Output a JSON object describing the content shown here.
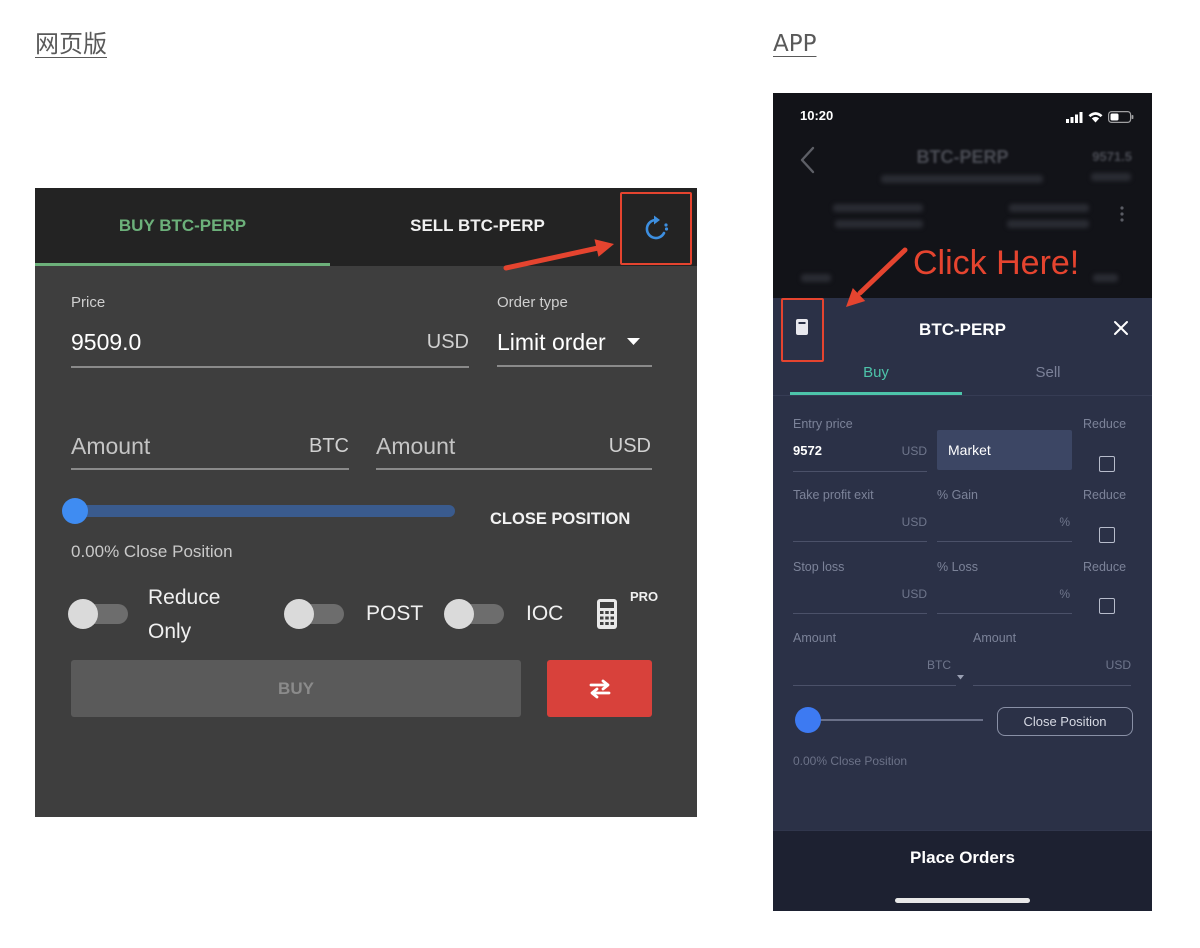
{
  "section_labels": {
    "web": "网页版",
    "app": "APP"
  },
  "annotations": {
    "click_here": "Click Here!"
  },
  "web": {
    "tabs": [
      {
        "label": "BUY BTC-PERP",
        "active": true
      },
      {
        "label": "SELL BTC-PERP",
        "active": false
      }
    ],
    "refresh_icon": "refresh-icon",
    "price": {
      "label": "Price",
      "value": "9509.0",
      "unit": "USD"
    },
    "order_type": {
      "label": "Order type",
      "value": "Limit order",
      "icon": "caret-down-icon"
    },
    "amount_btc": {
      "placeholder": "Amount",
      "unit": "BTC"
    },
    "amount_usd": {
      "placeholder": "Amount",
      "unit": "USD"
    },
    "slider": {
      "percent": 0
    },
    "close_position_button": "CLOSE POSITION",
    "close_position_status": "0.00% Close Position",
    "toggles": [
      {
        "label": "Reduce Only",
        "on": false
      },
      {
        "label": "POST",
        "on": false
      },
      {
        "label": "IOC",
        "on": false
      }
    ],
    "calculator_icon": "calculator-icon",
    "pro_badge": "PRO",
    "buy_button": "BUY",
    "swap_icon": "swap-arrows-icon",
    "colors": {
      "buy_green": "#6cb07a",
      "accent_blue": "#3f8cf2",
      "sell_red": "#d8413b",
      "annotation_red": "#e5442f"
    }
  },
  "app": {
    "status_bar": {
      "time": "10:20",
      "icons": [
        "cellular-signal-icon",
        "wifi-icon",
        "battery-icon"
      ]
    },
    "header": {
      "title": "BTC-PERP",
      "price": "9571.5",
      "back_icon": "back-chevron-icon",
      "more_icon": "more-vertical-icon"
    },
    "modal": {
      "icon": "order-ticket-icon",
      "title": "BTC-PERP",
      "close_icon": "close-icon",
      "tabs": [
        {
          "label": "Buy",
          "active": true
        },
        {
          "label": "Sell",
          "active": false
        }
      ],
      "entry_price": {
        "label": "Entry price",
        "value": "9572",
        "unit": "USD"
      },
      "order_type": {
        "value": "Market"
      },
      "reduce_label": "Reduce",
      "take_profit": {
        "label": "Take profit exit",
        "unit": "USD",
        "pct_label": "% Gain",
        "pct_unit": "%"
      },
      "stop_loss": {
        "label": "Stop loss",
        "unit": "USD",
        "pct_label": "% Loss",
        "pct_unit": "%"
      },
      "amount_btc": {
        "label": "Amount",
        "unit": "BTC"
      },
      "amount_usd": {
        "label": "Amount",
        "unit": "USD"
      },
      "reduce_checked": [
        false,
        false,
        false
      ],
      "slider": {
        "percent": 0
      },
      "close_position_button": "Close Position",
      "close_position_status": "0.00% Close Position",
      "place_orders_button": "Place Orders"
    },
    "colors": {
      "teal": "#4dc4aa"
    }
  }
}
